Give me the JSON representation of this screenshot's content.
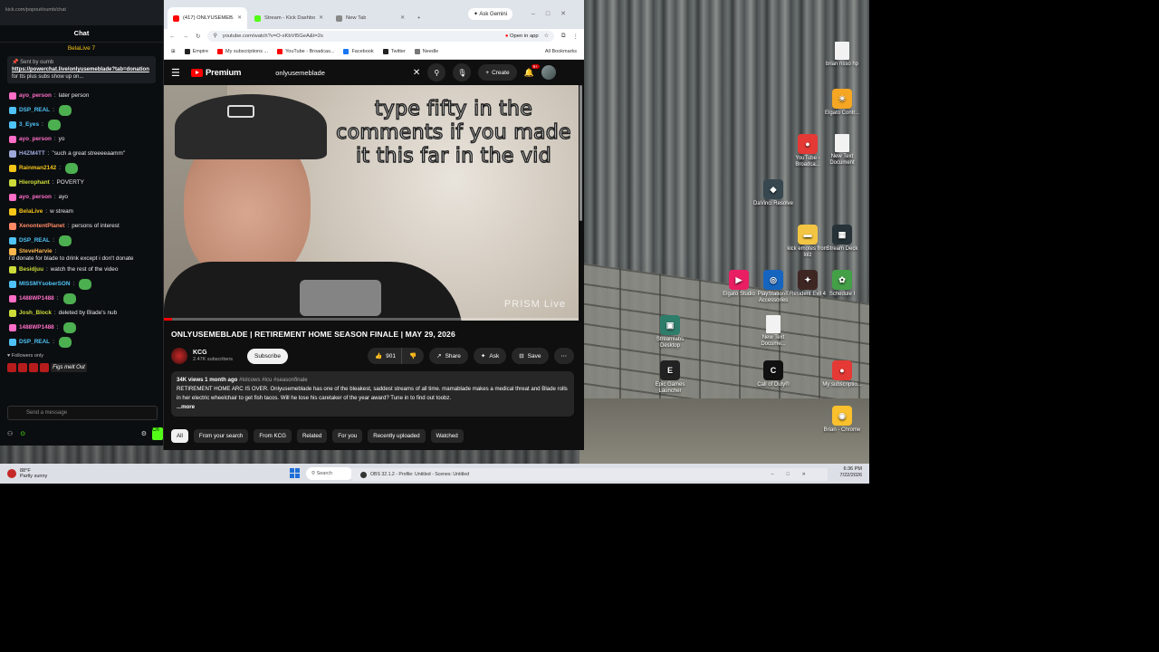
{
  "chat": {
    "browser_url": "kick.com/popout/oumb/chat",
    "title": "Chat",
    "pinned_user": "BelaLive 7",
    "pinned": {
      "sent_by_label": "Sent by",
      "sent_by_user": "oumb",
      "link": "https://powerchat.live/onlyusemeblade?tab=donation",
      "rest": "for tts plus subs show up on..."
    },
    "messages": [
      {
        "user": "ayo_person",
        "text": "later person",
        "color": "#ff6ec7"
      },
      {
        "user": "DSP_REAL",
        "text": "",
        "color": "#4fc3f7",
        "emote": true
      },
      {
        "user": "3_Eyes",
        "text": "",
        "color": "#4fc3f7",
        "emote": true
      },
      {
        "user": "ayo_person",
        "text": "yo",
        "color": "#ff6ec7"
      },
      {
        "user": "H4ZM4TT",
        "text": "\"such a great streeeeaamm\"",
        "color": "#9fa8da"
      },
      {
        "user": "Rainman2142",
        "text": "",
        "color": "#f5c518",
        "emote": true
      },
      {
        "user": "Hierophant",
        "text": "POVERTY",
        "color": "#cddc39"
      },
      {
        "user": "ayo_person",
        "text": "ayo",
        "color": "#ff6ec7"
      },
      {
        "user": "BelaLive",
        "text": "w stream",
        "color": "#f5c518"
      },
      {
        "user": "XenontentPlanet",
        "text": "persons of interest",
        "color": "#ff8a65"
      },
      {
        "user": "DSP_REAL",
        "text": "",
        "color": "#4fc3f7",
        "emote": true
      },
      {
        "user": "SteveHarvie",
        "text": "i'd donate for blade to drink except i don't donate",
        "color": "#ffb74d"
      },
      {
        "user": "Besidjuu",
        "text": "watch the rest of the video",
        "color": "#cddc39"
      },
      {
        "user": "MISSMYsoberSON",
        "text": "",
        "color": "#4fc3f7",
        "emote": true
      },
      {
        "user": "1488WP1488",
        "text": "",
        "color": "#ff6ec7",
        "emote": true
      },
      {
        "user": "Josh_Block",
        "text": "deleted by Blade's nub",
        "color": "#cddc39"
      },
      {
        "user": "1488WP1488",
        "text": "",
        "color": "#ff6ec7",
        "emote": true
      },
      {
        "user": "DSP_REAL",
        "text": "",
        "color": "#4fc3f7",
        "emote": true
      }
    ],
    "followers_label": "Followers only",
    "badge_text": "Figs melt Out",
    "input_placeholder": "Send a message",
    "send_label": "Ch"
  },
  "browser": {
    "tabs": [
      {
        "label": "(417) ONLYUSEMEB...",
        "color": "#ff0000",
        "active": true
      },
      {
        "label": "Stream - Kick Dashbo...",
        "color": "#53fc18",
        "active": false
      },
      {
        "label": "New Tab",
        "color": "#888888",
        "active": false
      }
    ],
    "ask_gemini": "Ask Gemini",
    "url": "youtube.com/watch?v=O-xKbVt5GeA&t=2s",
    "open_in_app": "Open in app",
    "bookmarks": [
      {
        "label": "Empire",
        "color": "#222222"
      },
      {
        "label": "My subscriptions ...",
        "color": "#ff0000"
      },
      {
        "label": "YouTube - Broadcas...",
        "color": "#ff0000"
      },
      {
        "label": "Facebook",
        "color": "#1877f2"
      },
      {
        "label": "Twitter",
        "color": "#222222"
      },
      {
        "label": "Needle",
        "color": "#777777"
      }
    ],
    "all_bookmarks": "All Bookmarks"
  },
  "youtube": {
    "logo": "Premium",
    "search_value": "onlyusemeblade",
    "create_label": "Create",
    "notif_count": "9+",
    "video": {
      "caption": "type fifty in the comments if you made it this far in the vid",
      "watermark": "PRISM Live",
      "progress": 0.02
    },
    "title": "ONLYUSEMEBLADE | RETIREMENT HOME SEASON FINALE | MAY 29, 2026",
    "channel": "KCG",
    "subs": "2.47K subscribers",
    "subscribe": "Subscribe",
    "likes": "901",
    "share": "Share",
    "ask": "Ask",
    "save": "Save",
    "desc_meta": "34K views  1 month ago",
    "desc_tags": "#lolcows #lcu #seasonfinale",
    "desc_text": "RETIREMENT HOME ARC IS OVER. Onlyusemeblade has one of the bleakest, saddest streams of all time. mamablade makes a medical threat and Blade rolls in her electric wheelchair to get fish tacos. Will he lose his caretaker of the year award? Tune in to find out toobz.",
    "desc_more": "...more",
    "chips": [
      "All",
      "From your search",
      "From KCG",
      "Related",
      "For you",
      "Recently uploaded",
      "Watched"
    ]
  },
  "desktop": {
    "icons": [
      {
        "label": "brian nsso hp",
        "color": "#f2f2f2",
        "kind": "doc"
      },
      {
        "label": "Elgato Contr...",
        "color": "#f5a623",
        "kind": "app",
        "g": "☀"
      },
      {
        "label": "YouTube - Broadca...",
        "color": "#e53935",
        "kind": "app",
        "g": "●"
      },
      {
        "label": "New Text Document",
        "color": "#f2f2f2",
        "kind": "doc"
      },
      {
        "label": "DaVinci Resolve",
        "color": "#37474f",
        "kind": "app",
        "g": "◆"
      },
      {
        "label": "kick emotes from lolz",
        "color": "#f4c542",
        "kind": "app",
        "g": "▬"
      },
      {
        "label": "Stream Deck",
        "color": "#263238",
        "kind": "app",
        "g": "▦"
      },
      {
        "label": "Elgato Studio",
        "color": "#e91e63",
        "kind": "app",
        "g": "▶"
      },
      {
        "label": "PlayStation® Accessories",
        "color": "#1565c0",
        "kind": "app",
        "g": "◎"
      },
      {
        "label": "Resident Evil 4",
        "color": "#3e2723",
        "kind": "app",
        "g": "✦"
      },
      {
        "label": "Schedule I",
        "color": "#43a047",
        "kind": "app",
        "g": "✿"
      },
      {
        "label": "Streamlabs Desktop",
        "color": "#2e7d6b",
        "kind": "app",
        "g": "▣"
      },
      {
        "label": "New Text Docume...",
        "color": "#f2f2f2",
        "kind": "doc"
      },
      {
        "label": "Epic Games Launcher",
        "color": "#222222",
        "kind": "app",
        "g": "E"
      },
      {
        "label": "Call of Duty®",
        "color": "#111111",
        "kind": "app",
        "g": "C"
      },
      {
        "label": "My subscriptio...",
        "color": "#e53935",
        "kind": "app",
        "g": "●"
      },
      {
        "label": "Brian - Chrome",
        "color": "#fbc02d",
        "kind": "app",
        "g": "◉"
      }
    ]
  },
  "taskbar": {
    "temp": "88°F",
    "weather": "Partly sunny",
    "search": "Search",
    "time": "6:36 PM",
    "date": "7/22/2026",
    "obs_title": "OBS 32.1.2 - Profile: Untitled - Scenes: Untitled"
  }
}
